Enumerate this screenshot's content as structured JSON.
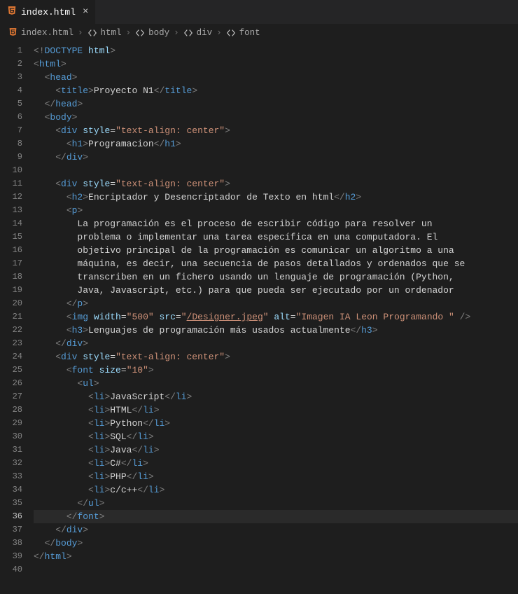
{
  "tab": {
    "filename": "index.html",
    "close_glyph": "×"
  },
  "breadcrumbs": {
    "segments": [
      "index.html",
      "html",
      "body",
      "div",
      "font"
    ],
    "sep": "›"
  },
  "editor": {
    "active_line": 36,
    "lines": [
      {
        "n": 1,
        "indent": 0,
        "tokens": [
          [
            "p",
            "<!"
          ],
          [
            "tg",
            "DOCTYPE "
          ],
          [
            "at",
            "html"
          ],
          [
            "p",
            ">"
          ]
        ]
      },
      {
        "n": 2,
        "indent": 0,
        "tokens": [
          [
            "p",
            "<"
          ],
          [
            "tg",
            "html"
          ],
          [
            "p",
            ">"
          ]
        ]
      },
      {
        "n": 3,
        "indent": 2,
        "tokens": [
          [
            "p",
            "<"
          ],
          [
            "tg",
            "head"
          ],
          [
            "p",
            ">"
          ]
        ]
      },
      {
        "n": 4,
        "indent": 4,
        "tokens": [
          [
            "p",
            "<"
          ],
          [
            "tg",
            "title"
          ],
          [
            "p",
            ">"
          ],
          [
            "tx",
            "Proyecto N1"
          ],
          [
            "p",
            "</"
          ],
          [
            "tg",
            "title"
          ],
          [
            "p",
            ">"
          ]
        ]
      },
      {
        "n": 5,
        "indent": 2,
        "tokens": [
          [
            "p",
            "</"
          ],
          [
            "tg",
            "head"
          ],
          [
            "p",
            ">"
          ]
        ]
      },
      {
        "n": 6,
        "indent": 2,
        "tokens": [
          [
            "p",
            "<"
          ],
          [
            "tg",
            "body"
          ],
          [
            "p",
            ">"
          ]
        ]
      },
      {
        "n": 7,
        "indent": 4,
        "tokens": [
          [
            "p",
            "<"
          ],
          [
            "tg",
            "div"
          ],
          [
            "tx",
            " "
          ],
          [
            "at",
            "style"
          ],
          [
            "op",
            "="
          ],
          [
            "st",
            "\"text-align: center\""
          ],
          [
            "p",
            ">"
          ]
        ]
      },
      {
        "n": 8,
        "indent": 6,
        "tokens": [
          [
            "p",
            "<"
          ],
          [
            "tg",
            "h1"
          ],
          [
            "p",
            ">"
          ],
          [
            "tx",
            "Programacion"
          ],
          [
            "p",
            "</"
          ],
          [
            "tg",
            "h1"
          ],
          [
            "p",
            ">"
          ]
        ]
      },
      {
        "n": 9,
        "indent": 4,
        "tokens": [
          [
            "p",
            "</"
          ],
          [
            "tg",
            "div"
          ],
          [
            "p",
            ">"
          ]
        ]
      },
      {
        "n": 10,
        "indent": 0,
        "tokens": []
      },
      {
        "n": 11,
        "indent": 4,
        "tokens": [
          [
            "p",
            "<"
          ],
          [
            "tg",
            "div"
          ],
          [
            "tx",
            " "
          ],
          [
            "at",
            "style"
          ],
          [
            "op",
            "="
          ],
          [
            "st",
            "\"text-align: center\""
          ],
          [
            "p",
            ">"
          ]
        ]
      },
      {
        "n": 12,
        "indent": 6,
        "tokens": [
          [
            "p",
            "<"
          ],
          [
            "tg",
            "h2"
          ],
          [
            "p",
            ">"
          ],
          [
            "tx",
            "Encriptador y Desencriptador de Texto en html"
          ],
          [
            "p",
            "</"
          ],
          [
            "tg",
            "h2"
          ],
          [
            "p",
            ">"
          ]
        ]
      },
      {
        "n": 13,
        "indent": 6,
        "tokens": [
          [
            "p",
            "<"
          ],
          [
            "tg",
            "p"
          ],
          [
            "p",
            ">"
          ]
        ]
      },
      {
        "n": 14,
        "indent": 8,
        "tokens": [
          [
            "tx",
            "La programación es el proceso de escribir código para resolver un"
          ]
        ]
      },
      {
        "n": 15,
        "indent": 8,
        "tokens": [
          [
            "tx",
            "problema o implementar una tarea específica en una computadora. El"
          ]
        ]
      },
      {
        "n": 16,
        "indent": 8,
        "tokens": [
          [
            "tx",
            "objetivo principal de la programación es comunicar un algoritmo a una"
          ]
        ]
      },
      {
        "n": 17,
        "indent": 8,
        "tokens": [
          [
            "tx",
            "máquina, es decir, una secuencia de pasos detallados y ordenados que se"
          ]
        ]
      },
      {
        "n": 18,
        "indent": 8,
        "tokens": [
          [
            "tx",
            "transcriben en un fichero usando un lenguaje de programación (Python,"
          ]
        ]
      },
      {
        "n": 19,
        "indent": 8,
        "tokens": [
          [
            "tx",
            "Java, Javascript, etc.) para que pueda ser ejecutado por un ordenador"
          ]
        ]
      },
      {
        "n": 20,
        "indent": 6,
        "tokens": [
          [
            "p",
            "</"
          ],
          [
            "tg",
            "p"
          ],
          [
            "p",
            ">"
          ]
        ]
      },
      {
        "n": 21,
        "indent": 6,
        "tokens": [
          [
            "p",
            "<"
          ],
          [
            "tg",
            "img"
          ],
          [
            "tx",
            " "
          ],
          [
            "at",
            "width"
          ],
          [
            "op",
            "="
          ],
          [
            "st",
            "\"500\""
          ],
          [
            "tx",
            " "
          ],
          [
            "at",
            "src"
          ],
          [
            "op",
            "="
          ],
          [
            "st",
            "\""
          ],
          [
            "lnk",
            "/Designer.jpeg"
          ],
          [
            "st",
            "\""
          ],
          [
            "tx",
            " "
          ],
          [
            "at",
            "alt"
          ],
          [
            "op",
            "="
          ],
          [
            "st",
            "\"Imagen IA Leon Programando \""
          ],
          [
            "tx",
            " "
          ],
          [
            "p",
            "/>"
          ]
        ]
      },
      {
        "n": 22,
        "indent": 6,
        "tokens": [
          [
            "p",
            "<"
          ],
          [
            "tg",
            "h3"
          ],
          [
            "p",
            ">"
          ],
          [
            "tx",
            "Lenguajes de programación más usados actualmente"
          ],
          [
            "p",
            "</"
          ],
          [
            "tg",
            "h3"
          ],
          [
            "p",
            ">"
          ]
        ]
      },
      {
        "n": 23,
        "indent": 4,
        "tokens": [
          [
            "p",
            "</"
          ],
          [
            "tg",
            "div"
          ],
          [
            "p",
            ">"
          ]
        ]
      },
      {
        "n": 24,
        "indent": 4,
        "tokens": [
          [
            "p",
            "<"
          ],
          [
            "tg",
            "div"
          ],
          [
            "tx",
            " "
          ],
          [
            "at",
            "style"
          ],
          [
            "op",
            "="
          ],
          [
            "st",
            "\"text-align: center\""
          ],
          [
            "p",
            ">"
          ]
        ]
      },
      {
        "n": 25,
        "indent": 6,
        "tokens": [
          [
            "p",
            "<"
          ],
          [
            "tg",
            "font"
          ],
          [
            "tx",
            " "
          ],
          [
            "at",
            "size"
          ],
          [
            "op",
            "="
          ],
          [
            "st",
            "\"10\""
          ],
          [
            "p",
            ">"
          ]
        ]
      },
      {
        "n": 26,
        "indent": 8,
        "tokens": [
          [
            "p",
            "<"
          ],
          [
            "tg",
            "ul"
          ],
          [
            "p",
            ">"
          ]
        ]
      },
      {
        "n": 27,
        "indent": 10,
        "tokens": [
          [
            "p",
            "<"
          ],
          [
            "tg",
            "li"
          ],
          [
            "p",
            ">"
          ],
          [
            "tx",
            "JavaScript"
          ],
          [
            "p",
            "</"
          ],
          [
            "tg",
            "li"
          ],
          [
            "p",
            ">"
          ]
        ]
      },
      {
        "n": 28,
        "indent": 10,
        "tokens": [
          [
            "p",
            "<"
          ],
          [
            "tg",
            "li"
          ],
          [
            "p",
            ">"
          ],
          [
            "tx",
            "HTML"
          ],
          [
            "p",
            "</"
          ],
          [
            "tg",
            "li"
          ],
          [
            "p",
            ">"
          ]
        ]
      },
      {
        "n": 29,
        "indent": 10,
        "tokens": [
          [
            "p",
            "<"
          ],
          [
            "tg",
            "li"
          ],
          [
            "p",
            ">"
          ],
          [
            "tx",
            "Python"
          ],
          [
            "p",
            "</"
          ],
          [
            "tg",
            "li"
          ],
          [
            "p",
            ">"
          ]
        ]
      },
      {
        "n": 30,
        "indent": 10,
        "tokens": [
          [
            "p",
            "<"
          ],
          [
            "tg",
            "li"
          ],
          [
            "p",
            ">"
          ],
          [
            "tx",
            "SQL"
          ],
          [
            "p",
            "</"
          ],
          [
            "tg",
            "li"
          ],
          [
            "p",
            ">"
          ]
        ]
      },
      {
        "n": 31,
        "indent": 10,
        "tokens": [
          [
            "p",
            "<"
          ],
          [
            "tg",
            "li"
          ],
          [
            "p",
            ">"
          ],
          [
            "tx",
            "Java"
          ],
          [
            "p",
            "</"
          ],
          [
            "tg",
            "li"
          ],
          [
            "p",
            ">"
          ]
        ]
      },
      {
        "n": 32,
        "indent": 10,
        "tokens": [
          [
            "p",
            "<"
          ],
          [
            "tg",
            "li"
          ],
          [
            "p",
            ">"
          ],
          [
            "tx",
            "C#"
          ],
          [
            "p",
            "</"
          ],
          [
            "tg",
            "li"
          ],
          [
            "p",
            ">"
          ]
        ]
      },
      {
        "n": 33,
        "indent": 10,
        "tokens": [
          [
            "p",
            "<"
          ],
          [
            "tg",
            "li"
          ],
          [
            "p",
            ">"
          ],
          [
            "tx",
            "PHP"
          ],
          [
            "p",
            "</"
          ],
          [
            "tg",
            "li"
          ],
          [
            "p",
            ">"
          ]
        ]
      },
      {
        "n": 34,
        "indent": 10,
        "tokens": [
          [
            "p",
            "<"
          ],
          [
            "tg",
            "li"
          ],
          [
            "p",
            ">"
          ],
          [
            "tx",
            "c/c++"
          ],
          [
            "p",
            "</"
          ],
          [
            "tg",
            "li"
          ],
          [
            "p",
            ">"
          ]
        ]
      },
      {
        "n": 35,
        "indent": 8,
        "tokens": [
          [
            "p",
            "</"
          ],
          [
            "tg",
            "ul"
          ],
          [
            "p",
            ">"
          ]
        ]
      },
      {
        "n": 36,
        "indent": 6,
        "tokens": [
          [
            "p",
            "</"
          ],
          [
            "tg",
            "font"
          ],
          [
            "p",
            ">"
          ]
        ]
      },
      {
        "n": 37,
        "indent": 4,
        "tokens": [
          [
            "p",
            "</"
          ],
          [
            "tg",
            "div"
          ],
          [
            "p",
            ">"
          ]
        ]
      },
      {
        "n": 38,
        "indent": 2,
        "tokens": [
          [
            "p",
            "</"
          ],
          [
            "tg",
            "body"
          ],
          [
            "p",
            ">"
          ]
        ]
      },
      {
        "n": 39,
        "indent": 0,
        "tokens": [
          [
            "p",
            "</"
          ],
          [
            "tg",
            "html"
          ],
          [
            "p",
            ">"
          ]
        ]
      },
      {
        "n": 40,
        "indent": 0,
        "tokens": []
      }
    ]
  }
}
